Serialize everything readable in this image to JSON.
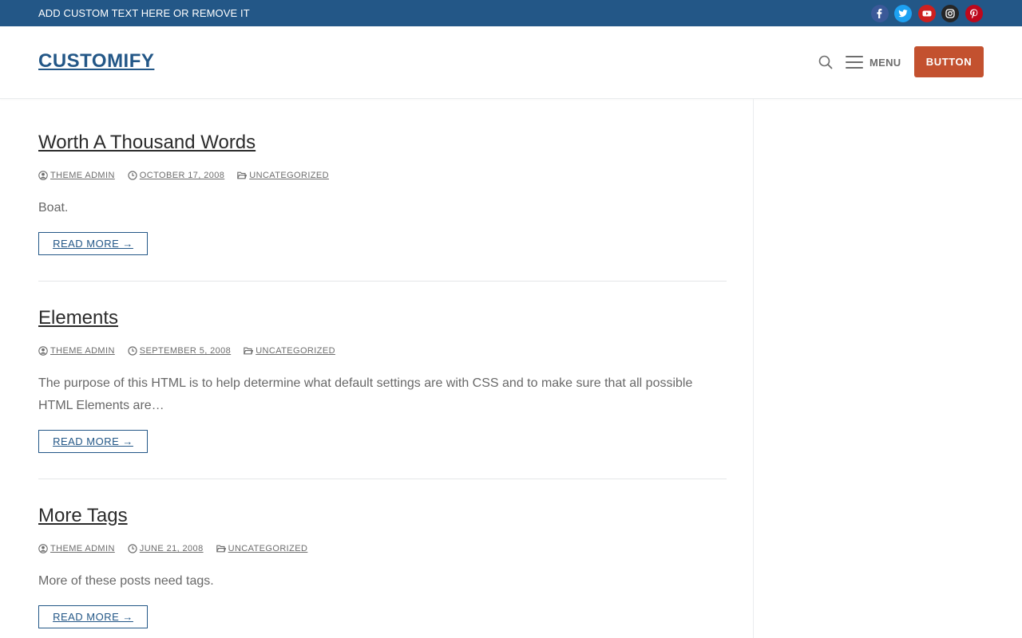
{
  "topbar": {
    "text": "ADD CUSTOM TEXT HERE OR REMOVE IT",
    "social": [
      {
        "icon": "facebook-icon",
        "color": "#3b5998"
      },
      {
        "icon": "twitter-icon",
        "color": "#1da1f2"
      },
      {
        "icon": "youtube-icon",
        "color": "#cd201f"
      },
      {
        "icon": "instagram-icon",
        "color": "#262626"
      },
      {
        "icon": "pinterest-icon",
        "color": "#bd081c"
      }
    ]
  },
  "header": {
    "logo": "CUSTOMIFY",
    "menu_label": "MENU",
    "button_label": "BUTTON",
    "button_color": "#c3512f"
  },
  "posts": [
    {
      "title": "Worth A Thousand Words",
      "author": "THEME ADMIN",
      "date": "OCTOBER 17, 2008",
      "category": "UNCATEGORIZED",
      "excerpt": "Boat.",
      "read_more": "READ MORE →"
    },
    {
      "title": "Elements",
      "author": "THEME ADMIN",
      "date": "SEPTEMBER 5, 2008",
      "category": "UNCATEGORIZED",
      "excerpt": "The purpose of this HTML is to help determine what default settings are with CSS and to make sure that all possible HTML Elements are…",
      "read_more": "READ MORE →"
    },
    {
      "title": "More Tags",
      "author": "THEME ADMIN",
      "date": "JUNE 21, 2008",
      "category": "UNCATEGORIZED",
      "excerpt": "More of these posts need tags.",
      "read_more": "READ MORE →"
    }
  ],
  "colors": {
    "topbar_bg": "#235787",
    "link": "#235787",
    "text": "#686868"
  }
}
